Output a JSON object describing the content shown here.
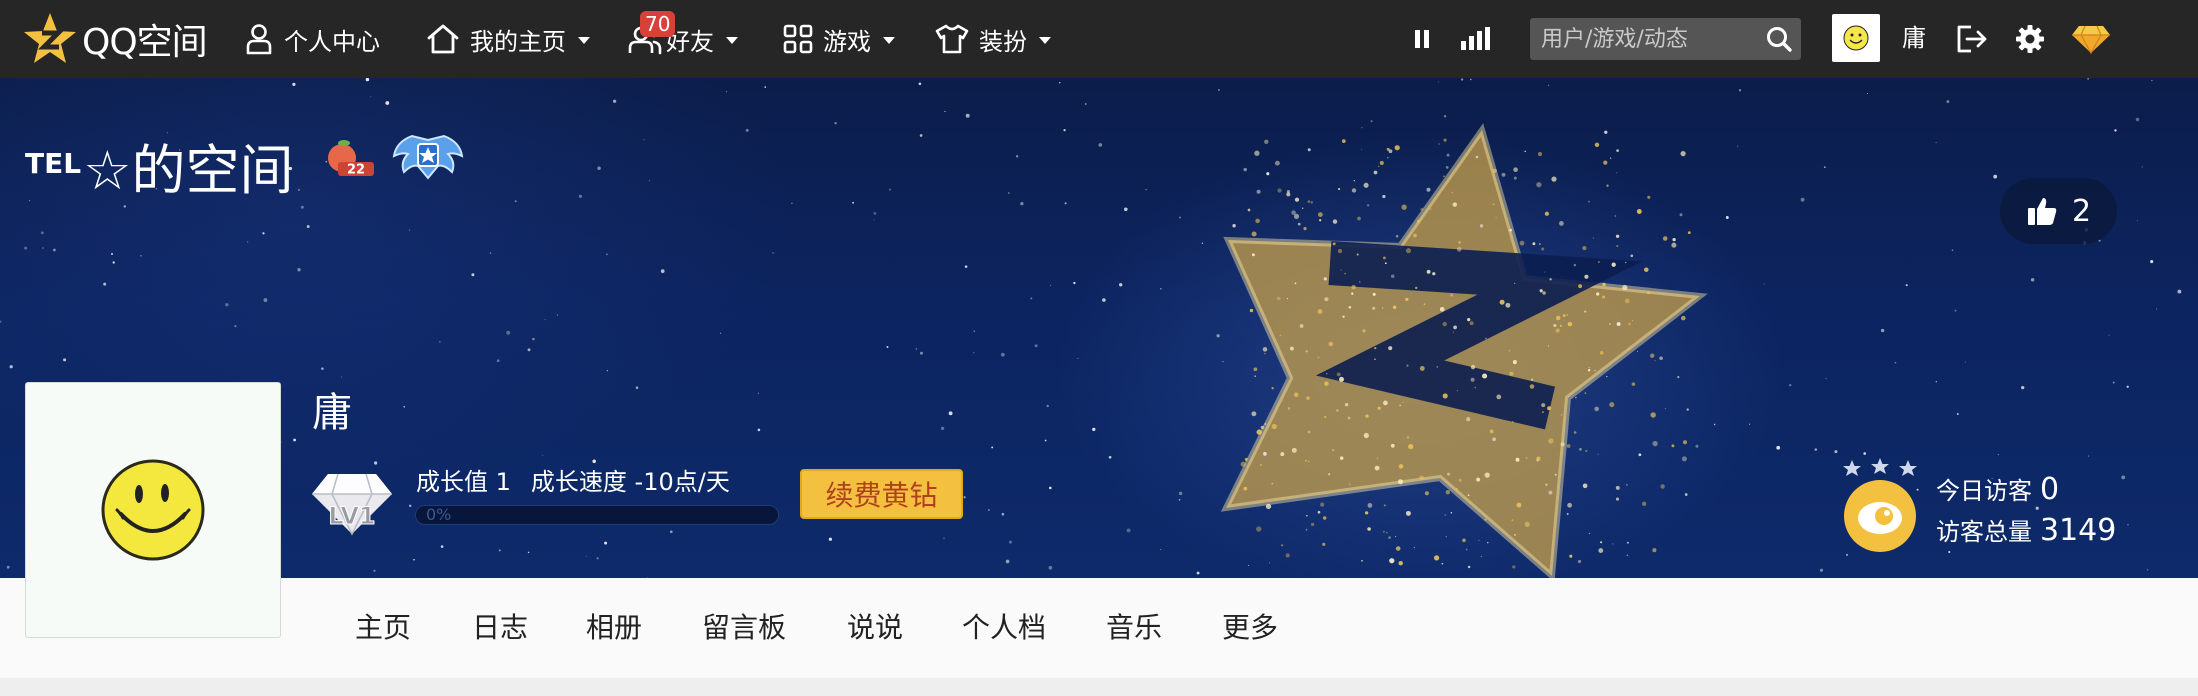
{
  "topbar": {
    "logo_text": "QQ空间",
    "nav": [
      {
        "label": "个人中心"
      },
      {
        "label": "我的主页"
      },
      {
        "label": "好友",
        "badge": "70"
      },
      {
        "label": "游戏"
      },
      {
        "label": "装扮"
      }
    ],
    "search_placeholder": "用户/游戏/动态",
    "username": "庸"
  },
  "banner": {
    "title_prefix": "TEL",
    "title_main": "☆的空间",
    "level_badge": "22",
    "likes": "2",
    "username": "庸",
    "growth_value_label": "成长值 1",
    "growth_speed_label": "成长速度 -10点/天",
    "progress_percent_text": "0%",
    "progress_fraction": 0,
    "level": "LV1",
    "renew_label": "续费黄钻",
    "visitors_today_label": "今日访客",
    "visitors_today": "0",
    "visitors_total_label": "访客总量",
    "visitors_total": "3149"
  },
  "tabs": [
    {
      "label": "主页"
    },
    {
      "label": "日志"
    },
    {
      "label": "相册"
    },
    {
      "label": "留言板"
    },
    {
      "label": "说说"
    },
    {
      "label": "个人档"
    },
    {
      "label": "音乐"
    },
    {
      "label": "更多"
    }
  ],
  "colors": {
    "topbar_bg": "#262626",
    "banner_bg": "#0c2460",
    "renew_button": "#f3c13f",
    "badge": "#d7413a",
    "logo_star": "#f3c13f"
  },
  "icons": [
    "qzone-logo-icon",
    "person-icon",
    "home-icon",
    "friends-icon",
    "grid-icon",
    "shirt-icon",
    "pause-icon",
    "signal-bars-icon",
    "search-icon",
    "smiley-avatar-icon",
    "logout-icon",
    "gear-icon",
    "diamond-icon",
    "thumbs-up-icon",
    "wing-badge-icon",
    "visitor-eye-icon",
    "peach-level-icon"
  ]
}
